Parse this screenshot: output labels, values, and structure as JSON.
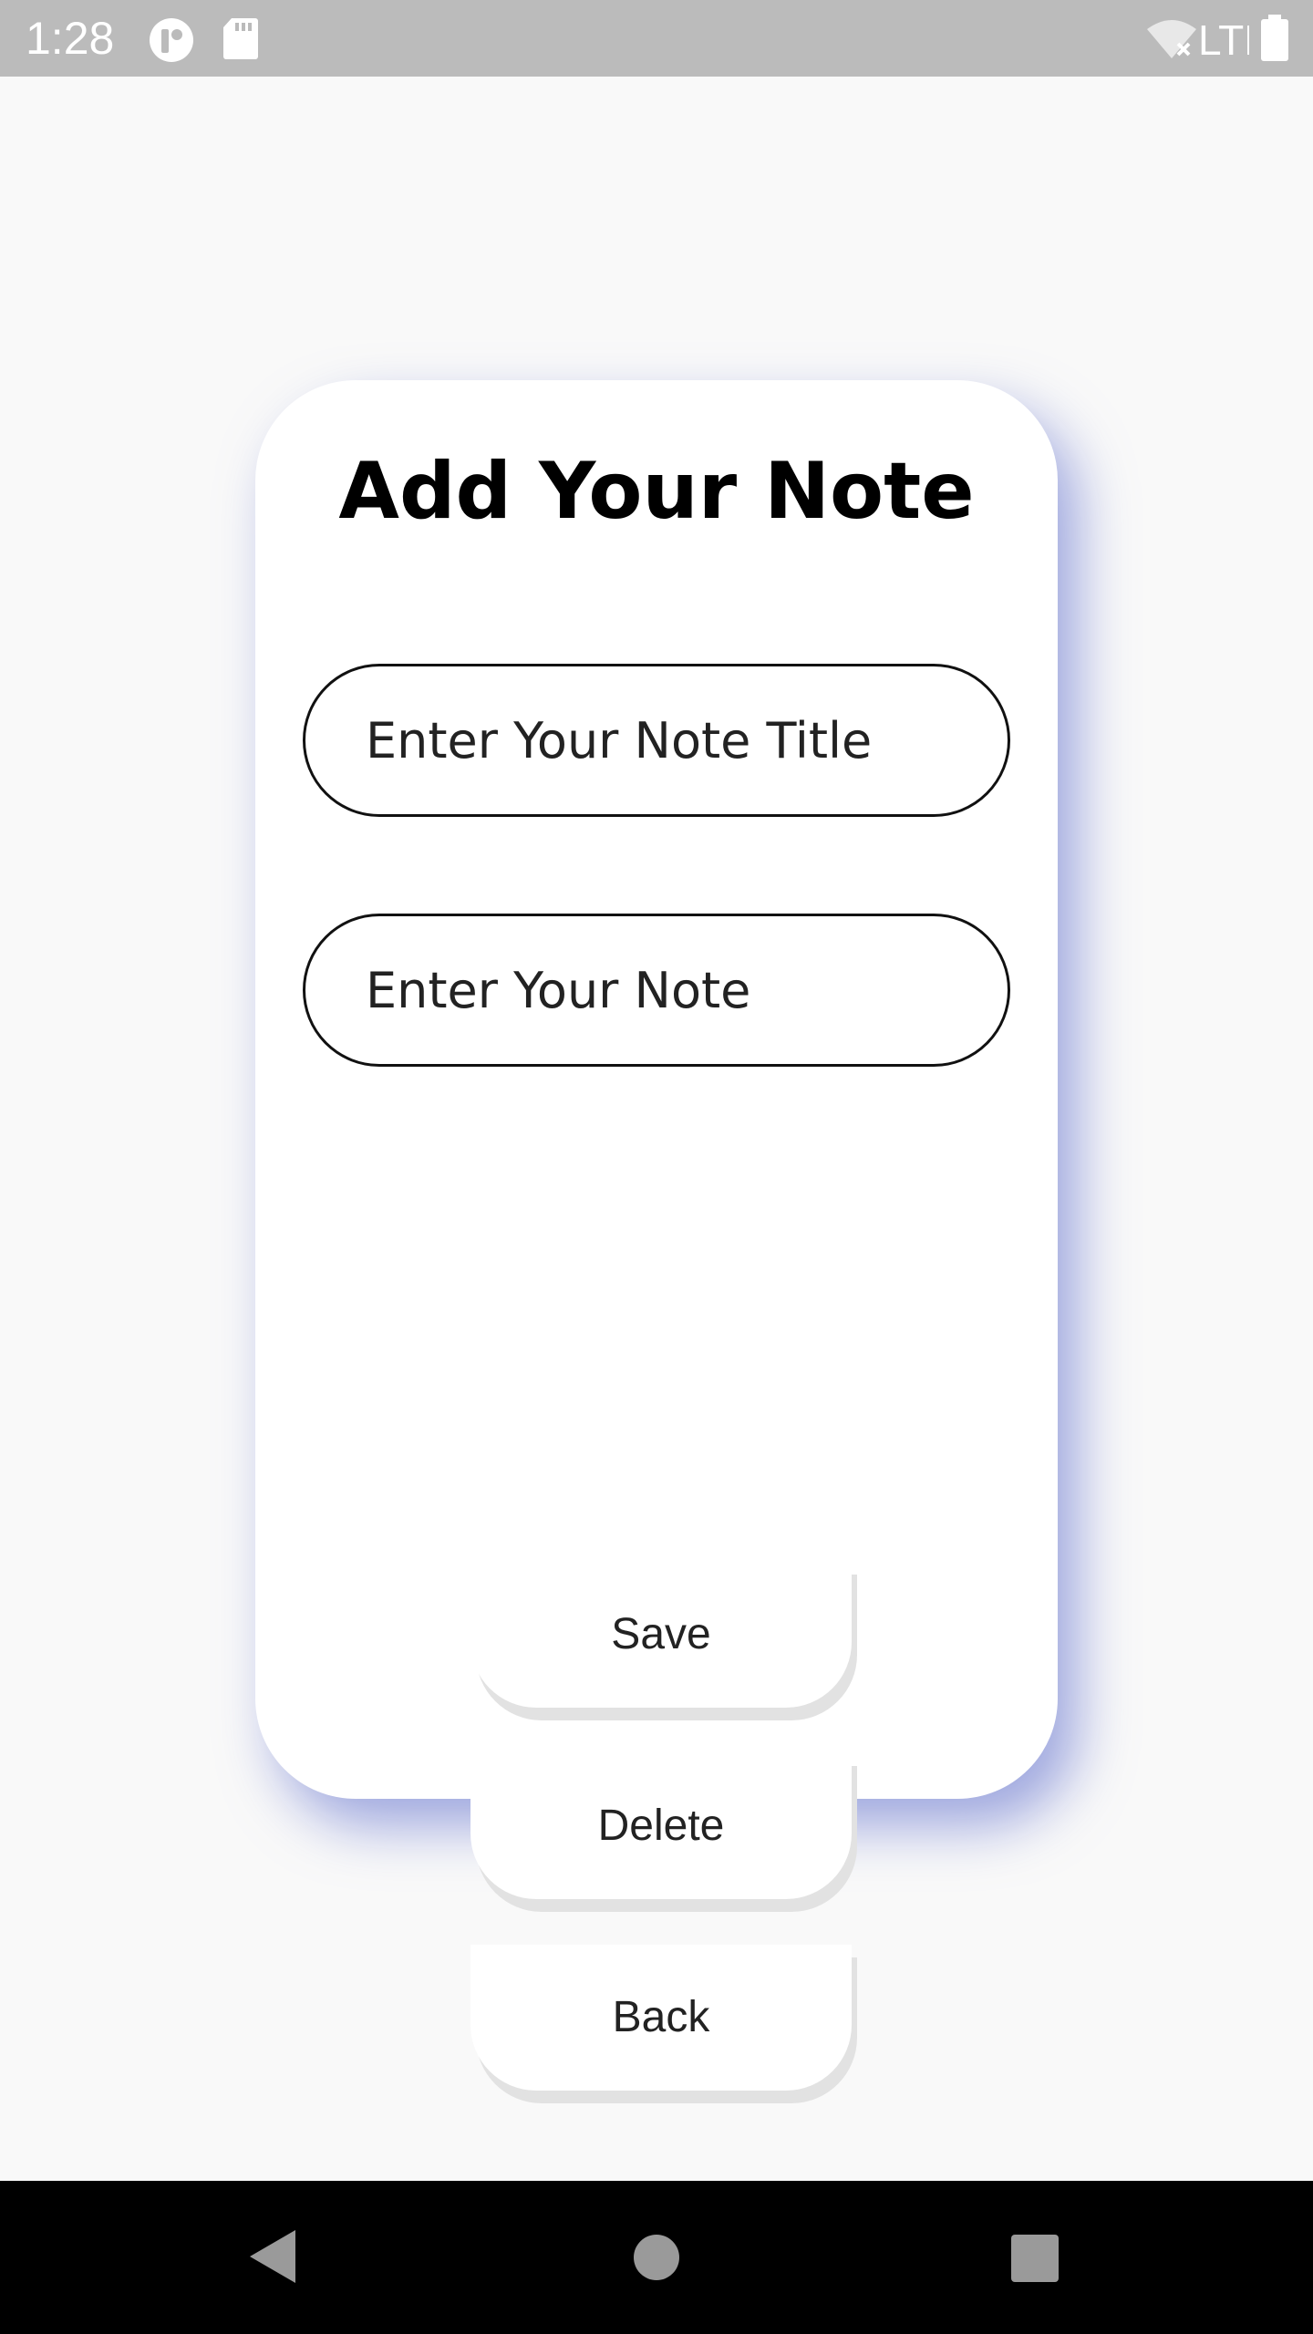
{
  "status_bar": {
    "time": "1:28",
    "network_label": "LTE",
    "icons": [
      "app-notification-icon",
      "sd-card-icon",
      "wifi-off-icon",
      "battery-icon"
    ]
  },
  "card": {
    "title": "Add Your Note",
    "title_input": {
      "value": "",
      "placeholder": "Enter Your Note Title"
    },
    "note_input": {
      "value": "",
      "placeholder": "Enter Your Note"
    },
    "buttons": {
      "save": "Save",
      "delete": "Delete",
      "back": "Back"
    }
  },
  "nav_bar": {
    "icons": [
      "back-icon",
      "home-icon",
      "recents-icon"
    ]
  },
  "colors": {
    "status_bar": "#bbbbbb",
    "background": "#f9f9f9",
    "card_shadow": "#7a87d4",
    "nav_bar": "#000000"
  }
}
